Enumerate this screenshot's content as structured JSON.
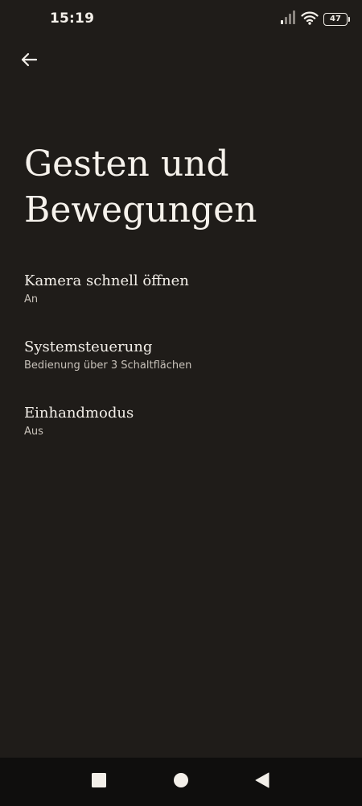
{
  "status_bar": {
    "time": "15:19",
    "battery_level": "47",
    "icons": [
      "signal-icon",
      "wifi-icon",
      "battery-icon"
    ]
  },
  "header": {
    "back_icon": "arrow-left-icon",
    "title": "Gesten und Bewegungen"
  },
  "settings": [
    {
      "title": "Kamera schnell öffnen",
      "summary": "An"
    },
    {
      "title": "Systemsteuerung",
      "summary": "Bedienung über 3 Schaltflächen"
    },
    {
      "title": "Einhandmodus",
      "summary": "Aus"
    }
  ],
  "nav_bar": {
    "buttons": [
      "recents-square-icon",
      "home-circle-icon",
      "back-triangle-icon"
    ]
  },
  "colors": {
    "background": "#1f1c19",
    "text_primary": "#f3efe9",
    "text_secondary": "#c7c1b9",
    "nav_bar": "#0f0e0d"
  }
}
